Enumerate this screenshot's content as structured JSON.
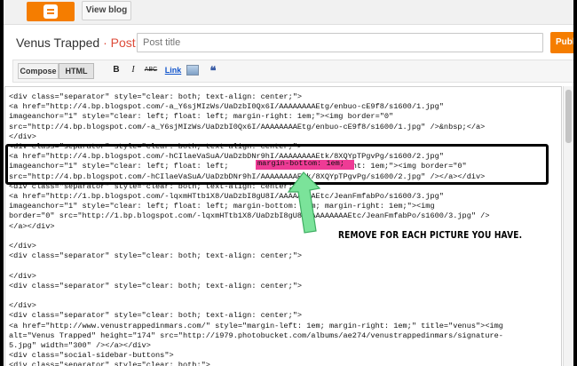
{
  "topbar": {
    "view_blog_label": "View blog"
  },
  "header": {
    "blog_name": "Venus Trapped",
    "separator": "·",
    "section": "Post",
    "post_title_placeholder": "Post title",
    "publish_label": "Publ"
  },
  "toolbar": {
    "compose_label": "Compose",
    "html_label": "HTML",
    "bold_label": "B",
    "italic_label": "I",
    "strike_label": "ABC",
    "link_label": "Link",
    "quote_label": "❝"
  },
  "editor": {
    "lines": [
      "<div class=\"separator\" style=\"clear: both; text-align: center;\">",
      "<a href=\"http://4.bp.blogspot.com/-a_Y6sjMIzWs/UaDzbI0Qx6I/AAAAAAAAEtg/enbuo-cE9f8/s1600/1.jpg\"",
      "imageanchor=\"1\" style=\"clear: left; float: left; margin-right: 1em;\"><img border=\"0\"",
      "src=\"http://4.bp.blogspot.com/-a_Y6sjMIzWs/UaDzbI0Qx6I/AAAAAAAAEtg/enbuo-cE9f8/s1600/1.jpg\" />&nbsp;</a>",
      "</div>",
      "<div class=\"separator\" style=\"clear: both; text-align: center;\">",
      "<a href=\"http://4.bp.blogspot.com/-hCIlaeVaSuA/UaDzbDNr9hI/AAAAAAAAEtk/8XQYpTPgvPg/s1600/2.jpg\"",
      "imageanchor=\"1\" style=\"clear: left; float: left;                 margin-right: 1em;\"><img border=\"0\"",
      "src=\"http://4.bp.blogspot.com/-hCIlaeVaSuA/UaDzbDNr9hI/AAAAAAAAEtk/8XQYpTPgvPg/s1600/2.jpg\" /></a></div>",
      "<div class=\"separator\" style=\"clear: both; text-align: center;\">",
      "<a href=\"http://1.bp.blogspot.com/-lqxmHTtb1X8/UaDzbI8gU8I/AAAAAAAAEtc/JeanFmfabPo/s1600/3.jpg\"",
      "imageanchor=\"1\" style=\"clear: left; float: left; margin-bottom: 1em; margin-right: 1em;\"><img",
      "border=\"0\" src=\"http://1.bp.blogspot.com/-lqxmHTtb1X8/UaDzbI8gU8I/AAAAAAAAEtc/JeanFmfabPo/s1600/3.jpg\" />",
      "</a></div>",
      "",
      "</div>",
      "<div class=\"separator\" style=\"clear: both; text-align: center;\">",
      "",
      "</div>",
      "<div class=\"separator\" style=\"clear: both; text-align: center;\">",
      "",
      "</div>",
      "<div class=\"separator\" style=\"clear: both; text-align: center;\">",
      "<a href=\"http://www.venustrappedinmars.com/\" style=\"margin-left: 1em; margin-right: 1em;\" title=\"venus\"><img",
      "alt=\"Venus Trapped\" height=\"174\" src=\"http://i979.photobucket.com/albums/ae274/venustrappedinmars/signature-",
      "5.jpg\" width=\"300\" /></a></div>",
      "<div class=\"social-sidebar-buttons\">",
      "<div class=\"separator\" style=\"clear: both;\">"
    ],
    "highlighted_text": "margin-bottom: 1em;"
  },
  "annotation": {
    "text": "REMOVE FOR EACH PICTURE YOU HAVE.",
    "box_color": "#000000",
    "highlight_color": "#ee3b95",
    "arrow_color": "#7be39a"
  }
}
